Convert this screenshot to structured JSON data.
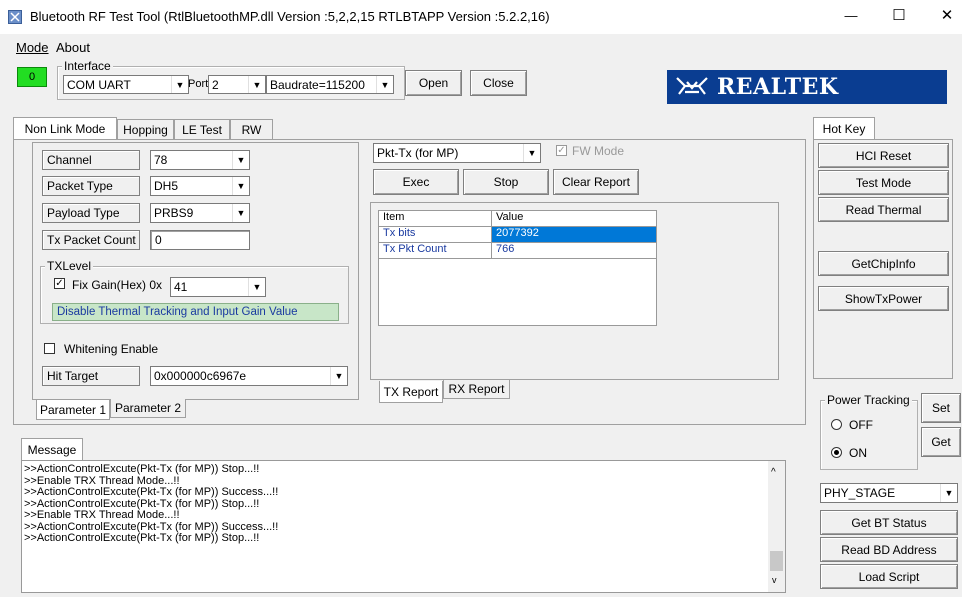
{
  "window": {
    "title": "Bluetooth RF Test Tool (RtlBluetoothMP.dll Version :5,2,2,15   RTLBTAPP Version :5.2.2,16)",
    "minimize": "—",
    "maximize": "☐",
    "close": "✕"
  },
  "menu": {
    "mode": "Mode",
    "about": "About"
  },
  "interface": {
    "title": "Interface",
    "status": "0",
    "status_color": "#22dd22",
    "type": "COM UART",
    "port_label": "Port",
    "port": "2",
    "baudrate": "Baudrate=115200",
    "open": "Open",
    "close": "Close"
  },
  "brand": {
    "name": "REALTEK",
    "color": "#0a3d91"
  },
  "main_tabs": [
    "Non Link Mode",
    "Hopping",
    "LE Test",
    "RW"
  ],
  "params": {
    "channel_label": "Channel",
    "channel": "78",
    "packet_type_label": "Packet Type",
    "packet_type": "DH5",
    "payload_type_label": "Payload Type",
    "payload_type": "PRBS9",
    "tx_count_label": "Tx Packet Count",
    "tx_count": "0",
    "txlevel_title": "TXLevel",
    "fix_gain_label": "Fix Gain(Hex)  0x",
    "fix_gain": "41",
    "thermal_note": "Disable Thermal Tracking and Input Gain Value",
    "whitening_label": "Whitening Enable",
    "hit_target_label": "Hit Target",
    "hit_target": "0x000000c6967e",
    "sub_tabs": [
      "Parameter 1",
      "Parameter 2"
    ]
  },
  "test": {
    "mode": "Pkt-Tx (for MP)",
    "fw_mode": "FW Mode",
    "exec": "Exec",
    "stop": "Stop",
    "clear": "Clear Report",
    "table_headers": [
      "Item",
      "Value"
    ],
    "rows": [
      {
        "item": "Tx bits",
        "value": "2077392"
      },
      {
        "item": "Tx Pkt Count",
        "value": "766"
      }
    ],
    "report_tabs": [
      "TX Report",
      "RX Report"
    ]
  },
  "hotkey": {
    "tab": "Hot Key",
    "buttons": [
      "HCI Reset",
      "Test Mode",
      "Read Thermal"
    ],
    "buttons2": [
      "GetChipInfo",
      "ShowTxPower"
    ]
  },
  "power_tracking": {
    "title": "Power Tracking",
    "off": "OFF",
    "on": "ON",
    "set": "Set",
    "get": "Get"
  },
  "stage": {
    "select": "PHY_STAGE",
    "buttons": [
      "Get BT Status",
      "Read BD Address",
      "Load Script"
    ]
  },
  "message": {
    "tab": "Message",
    "lines": [
      ">>ActionControlExcute(Pkt-Tx (for MP)) Stop...!!",
      ">>Enable TRX Thread Mode...!!",
      ">>ActionControlExcute(Pkt-Tx (for MP)) Success...!!",
      ">>ActionControlExcute(Pkt-Tx (for MP)) Stop...!!",
      ">>Enable TRX Thread Mode...!!",
      ">>ActionControlExcute(Pkt-Tx (for MP)) Success...!!",
      ">>ActionControlExcute(Pkt-Tx (for MP)) Stop...!!"
    ]
  },
  "colors": {
    "selection": "#0078d7",
    "note_bg": "#c8e6c8",
    "note_text": "#1a3aa0"
  }
}
